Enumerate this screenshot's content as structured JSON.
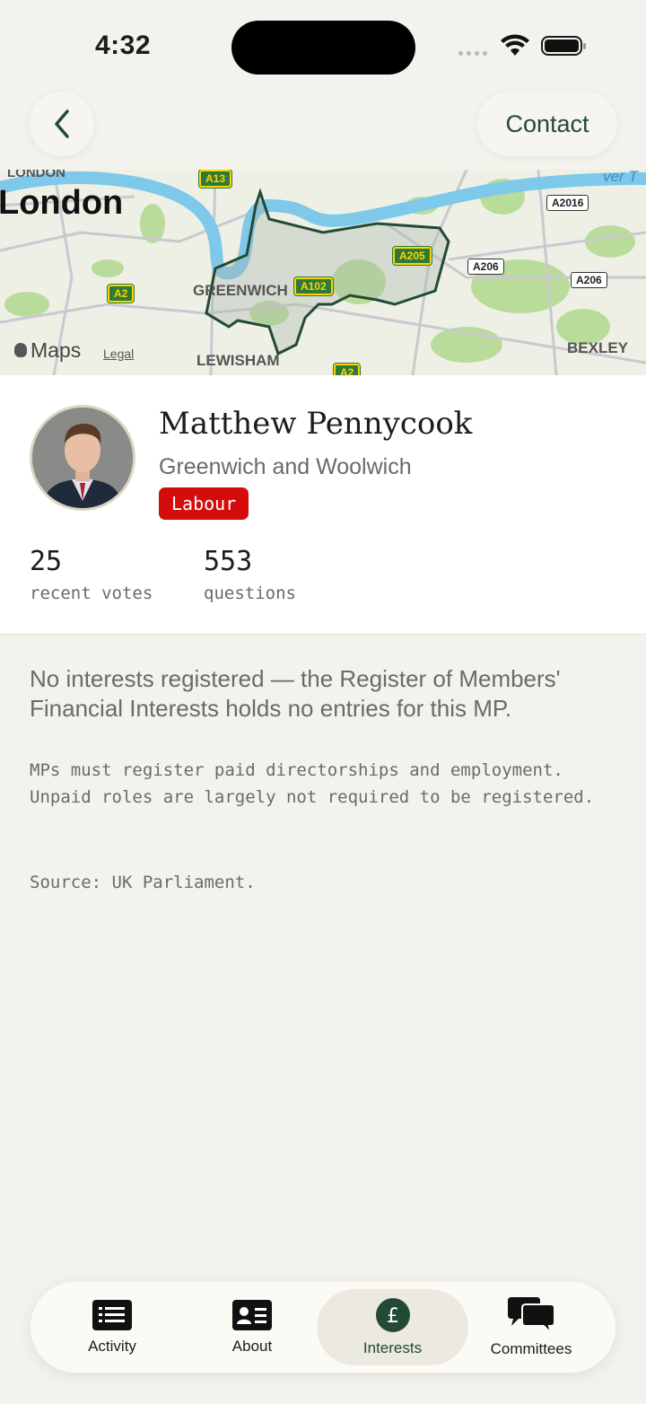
{
  "status_bar": {
    "time": "4:32"
  },
  "nav": {
    "contact_label": "Contact"
  },
  "map": {
    "labels": {
      "london_small": "LONDON",
      "london": "London",
      "greenwich": "GREENWICH",
      "lewisham": "LEWISHAM",
      "bexley": "BEXLEY",
      "river": "ver T"
    },
    "roads": {
      "a13": "A13",
      "a2_left": "A2",
      "a102": "A102",
      "a205": "A205",
      "a206_a": "A206",
      "a206_b": "A206",
      "a2016": "A2016",
      "a2_bottom": "A2"
    },
    "attribution": {
      "maps": "Maps",
      "legal": "Legal"
    }
  },
  "profile": {
    "name": "Matthew Pennycook",
    "constituency": "Greenwich and Woolwich",
    "party": "Labour",
    "party_color": "#d40c0c",
    "stats": [
      {
        "value": "25",
        "label": "recent votes"
      },
      {
        "value": "553",
        "label": "questions"
      }
    ]
  },
  "interests": {
    "lead": "No interests registered — the Register of Members' Financial Interests holds no entries for this MP.",
    "note": "MPs must register paid directorships and employment. Unpaid roles are largely not required to be registered.",
    "source": "Source: UK Parliament."
  },
  "tabs": [
    {
      "label": "Activity",
      "icon": "list-icon"
    },
    {
      "label": "About",
      "icon": "id-card-icon"
    },
    {
      "label": "Interests",
      "icon": "pound-icon",
      "active": true
    },
    {
      "label": "Committees",
      "icon": "chat-bubbles-icon"
    }
  ],
  "colors": {
    "accent": "#234a36",
    "background": "#f4f2ec"
  }
}
